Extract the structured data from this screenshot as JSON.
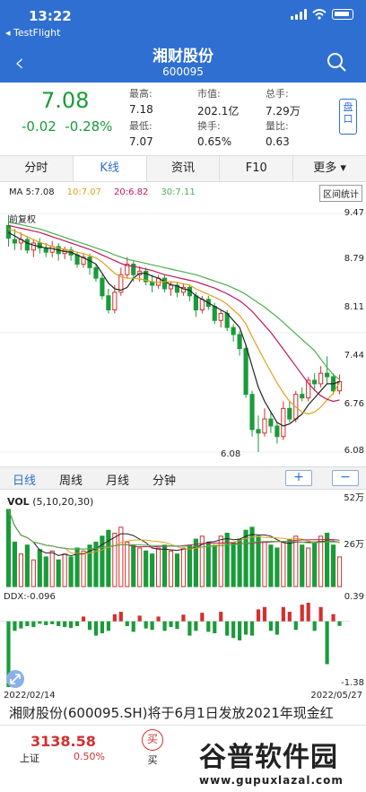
{
  "status": {
    "time": "13:22",
    "back_app": "◂ TestFlight"
  },
  "header": {
    "title": "湘财股份",
    "code": "600095"
  },
  "quote": {
    "price": "7.08",
    "change": "-0.02",
    "change_pct": "-0.28%",
    "fields": [
      {
        "k": "最高:",
        "v": "7.18"
      },
      {
        "k": "市值:",
        "v": "202.1亿"
      },
      {
        "k": "总手:",
        "v": "7.29万"
      },
      {
        "k": "最低:",
        "v": "7.07"
      },
      {
        "k": "换手:",
        "v": "0.65%"
      },
      {
        "k": "量比:",
        "v": "0.63"
      }
    ],
    "pan_button": "盘口"
  },
  "tabs": [
    "分时",
    "K线",
    "资讯",
    "F10",
    "更多"
  ],
  "ma": {
    "ma5": "MA 5:7.08",
    "ma10": "10:7.07",
    "ma20": "20:6.82",
    "ma30": "30:7.11",
    "range_button": "区间统计",
    "fuquan": "前复权"
  },
  "colors": {
    "up": "#d32f2f",
    "down": "#1a9b3a",
    "ma5": "#222222",
    "ma10": "#e0a020",
    "ma20": "#c2185b",
    "ma30": "#4caf50",
    "accent": "#2f6fd1"
  },
  "price_axis": {
    "labels": [
      "9.47",
      "8.79",
      "8.11",
      "7.44",
      "6.76",
      "6.08"
    ],
    "low_label": "6.08"
  },
  "period_tabs": [
    "日线",
    "周线",
    "月线",
    "分钟"
  ],
  "zoom": {
    "plus": "+",
    "minus": "−"
  },
  "volume": {
    "label": "VOL",
    "params": "(5,10,20,30)",
    "axis": [
      "52万",
      "26万"
    ]
  },
  "ddx": {
    "label": "DDX:-0.096",
    "axis": [
      "0.39",
      "-1.38"
    ]
  },
  "dates": {
    "start": "2022/02/14",
    "end": "2022/05/27"
  },
  "news": "湘财股份(600095.SH)将于6月1日发放2021年现金红",
  "bottom": {
    "index_value": "3138.58",
    "index_name": "上证",
    "index_pct": "0.50%",
    "buy_label": "买",
    "buy_icon": "买"
  },
  "watermark": {
    "main": "谷普软件园",
    "url": "www.gupuxlazal.com"
  },
  "chart_data": {
    "type": "candlestick",
    "ylim": [
      6.08,
      9.47
    ],
    "candles": [
      [
        9.3,
        9.12,
        9.45,
        9.0
      ],
      [
        9.1,
        9.05,
        9.25,
        8.95
      ],
      [
        9.05,
        9.1,
        9.2,
        8.95
      ],
      [
        9.1,
        8.95,
        9.15,
        8.9
      ],
      [
        8.95,
        9.05,
        9.1,
        8.85
      ],
      [
        9.05,
        8.98,
        9.12,
        8.9
      ],
      [
        8.98,
        8.92,
        9.05,
        8.85
      ],
      [
        8.92,
        9.0,
        9.08,
        8.85
      ],
      [
        9.0,
        8.9,
        9.05,
        8.8
      ],
      [
        8.9,
        8.95,
        9.0,
        8.82
      ],
      [
        8.95,
        8.88,
        9.0,
        8.8
      ],
      [
        8.88,
        8.75,
        8.92,
        8.7
      ],
      [
        8.75,
        8.85,
        8.9,
        8.7
      ],
      [
        8.85,
        8.7,
        8.9,
        8.6
      ],
      [
        8.7,
        8.55,
        8.75,
        8.5
      ],
      [
        8.55,
        8.3,
        8.6,
        8.25
      ],
      [
        8.3,
        8.1,
        8.4,
        8.05
      ],
      [
        8.1,
        8.35,
        8.45,
        8.05
      ],
      [
        8.35,
        8.6,
        8.7,
        8.3
      ],
      [
        8.6,
        8.75,
        8.85,
        8.55
      ],
      [
        8.75,
        8.6,
        8.8,
        8.5
      ],
      [
        8.6,
        8.65,
        8.72,
        8.5
      ],
      [
        8.65,
        8.5,
        8.7,
        8.45
      ],
      [
        8.5,
        8.45,
        8.6,
        8.35
      ],
      [
        8.45,
        8.55,
        8.6,
        8.4
      ],
      [
        8.55,
        8.4,
        8.6,
        8.35
      ],
      [
        8.4,
        8.45,
        8.5,
        8.3
      ],
      [
        8.45,
        8.35,
        8.5,
        8.28
      ],
      [
        8.35,
        8.42,
        8.48,
        8.3
      ],
      [
        8.42,
        8.3,
        8.46,
        8.22
      ],
      [
        8.3,
        8.1,
        8.35,
        8.0
      ],
      [
        8.1,
        8.25,
        8.3,
        8.05
      ],
      [
        8.25,
        8.15,
        8.3,
        8.1
      ],
      [
        8.15,
        7.95,
        8.2,
        7.9
      ],
      [
        7.95,
        8.05,
        8.1,
        7.85
      ],
      [
        8.05,
        7.85,
        8.1,
        7.8
      ],
      [
        7.85,
        7.75,
        7.9,
        7.65
      ],
      [
        7.75,
        7.55,
        7.8,
        7.45
      ],
      [
        7.55,
        6.9,
        7.6,
        6.85
      ],
      [
        6.9,
        6.4,
        6.95,
        6.3
      ],
      [
        6.4,
        6.35,
        6.6,
        6.08
      ],
      [
        6.35,
        6.55,
        6.7,
        6.3
      ],
      [
        6.55,
        6.45,
        6.65,
        6.35
      ],
      [
        6.45,
        6.3,
        6.5,
        6.2
      ],
      [
        6.3,
        6.7,
        6.8,
        6.25
      ],
      [
        6.7,
        6.55,
        6.8,
        6.5
      ],
      [
        6.55,
        6.9,
        6.95,
        6.5
      ],
      [
        6.9,
        6.85,
        7.0,
        6.8
      ],
      [
        6.85,
        7.1,
        7.15,
        6.8
      ],
      [
        7.1,
        7.05,
        7.2,
        6.95
      ],
      [
        7.05,
        7.2,
        7.3,
        7.0
      ],
      [
        7.2,
        7.15,
        7.44,
        7.05
      ],
      [
        7.15,
        6.95,
        7.2,
        6.9
      ],
      [
        6.95,
        7.08,
        7.18,
        6.9
      ]
    ],
    "ma5": [
      9.2,
      9.15,
      9.1,
      9.05,
      9.02,
      9.0,
      8.98,
      8.97,
      8.95,
      8.93,
      8.92,
      8.88,
      8.84,
      8.8,
      8.75,
      8.62,
      8.48,
      8.4,
      8.38,
      8.42,
      8.55,
      8.62,
      8.62,
      8.58,
      8.55,
      8.5,
      8.46,
      8.44,
      8.4,
      8.38,
      8.3,
      8.25,
      8.2,
      8.15,
      8.1,
      8.05,
      7.95,
      7.85,
      7.6,
      7.3,
      7.0,
      6.8,
      6.65,
      6.5,
      6.45,
      6.48,
      6.55,
      6.62,
      6.75,
      6.85,
      6.95,
      7.05,
      7.05,
      7.08
    ],
    "ma10": [
      9.25,
      9.22,
      9.18,
      9.14,
      9.1,
      9.06,
      9.03,
      9.0,
      8.98,
      8.96,
      8.94,
      8.92,
      8.9,
      8.87,
      8.84,
      8.78,
      8.7,
      8.62,
      8.57,
      8.55,
      8.55,
      8.54,
      8.52,
      8.5,
      8.49,
      8.5,
      8.5,
      8.49,
      8.47,
      8.45,
      8.4,
      8.36,
      8.32,
      8.28,
      8.24,
      8.18,
      8.1,
      8.02,
      7.9,
      7.72,
      7.55,
      7.38,
      7.22,
      7.06,
      6.92,
      6.8,
      6.72,
      6.65,
      6.62,
      6.65,
      6.72,
      6.82,
      6.92,
      7.07
    ],
    "ma20": [
      9.3,
      9.28,
      9.26,
      9.24,
      9.22,
      9.2,
      9.17,
      9.14,
      9.11,
      9.08,
      9.05,
      9.02,
      8.99,
      8.96,
      8.92,
      8.88,
      8.84,
      8.8,
      8.76,
      8.73,
      8.72,
      8.7,
      8.68,
      8.66,
      8.63,
      8.6,
      8.58,
      8.56,
      8.54,
      8.52,
      8.5,
      8.47,
      8.44,
      8.41,
      8.37,
      8.33,
      8.28,
      8.23,
      8.16,
      8.08,
      7.98,
      7.88,
      7.78,
      7.66,
      7.54,
      7.42,
      7.3,
      7.18,
      7.06,
      6.96,
      6.88,
      6.83,
      6.8,
      6.82
    ],
    "ma30": [
      9.35,
      9.33,
      9.31,
      9.29,
      9.27,
      9.25,
      9.22,
      9.19,
      9.16,
      9.13,
      9.1,
      9.07,
      9.04,
      9.01,
      8.98,
      8.95,
      8.92,
      8.88,
      8.85,
      8.82,
      8.8,
      8.78,
      8.76,
      8.74,
      8.72,
      8.7,
      8.68,
      8.66,
      8.64,
      8.62,
      8.6,
      8.57,
      8.54,
      8.51,
      8.48,
      8.45,
      8.41,
      8.37,
      8.32,
      8.26,
      8.2,
      8.14,
      8.07,
      8.0,
      7.92,
      7.84,
      7.76,
      7.68,
      7.6,
      7.52,
      7.4,
      7.28,
      7.18,
      7.11
    ],
    "volume": [
      52,
      30,
      22,
      28,
      18,
      25,
      20,
      24,
      18,
      22,
      20,
      26,
      24,
      28,
      30,
      34,
      38,
      36,
      40,
      30,
      28,
      26,
      24,
      22,
      26,
      28,
      24,
      22,
      26,
      28,
      32,
      34,
      30,
      28,
      34,
      36,
      30,
      32,
      38,
      40,
      34,
      30,
      28,
      26,
      30,
      32,
      34,
      28,
      26,
      30,
      34,
      36,
      28,
      20
    ],
    "ddx": [
      -1.38,
      -0.2,
      -0.15,
      -0.1,
      -0.12,
      -0.05,
      -0.08,
      -0.06,
      -0.1,
      -0.12,
      -0.14,
      -0.1,
      0.1,
      -0.18,
      -0.3,
      -0.25,
      -0.2,
      0.15,
      0.2,
      -0.1,
      -0.22,
      0.12,
      -0.15,
      -0.18,
      0.1,
      -0.2,
      -0.12,
      -0.16,
      0.14,
      -0.3,
      -0.2,
      0.18,
      -0.22,
      -0.25,
      0.2,
      -0.3,
      -0.35,
      -0.4,
      -0.28,
      -0.3,
      0.25,
      0.3,
      -0.2,
      -0.28,
      0.3,
      0.2,
      -0.18,
      0.35,
      0.39,
      -0.2,
      0.3,
      -0.9,
      0.15,
      -0.096
    ]
  }
}
